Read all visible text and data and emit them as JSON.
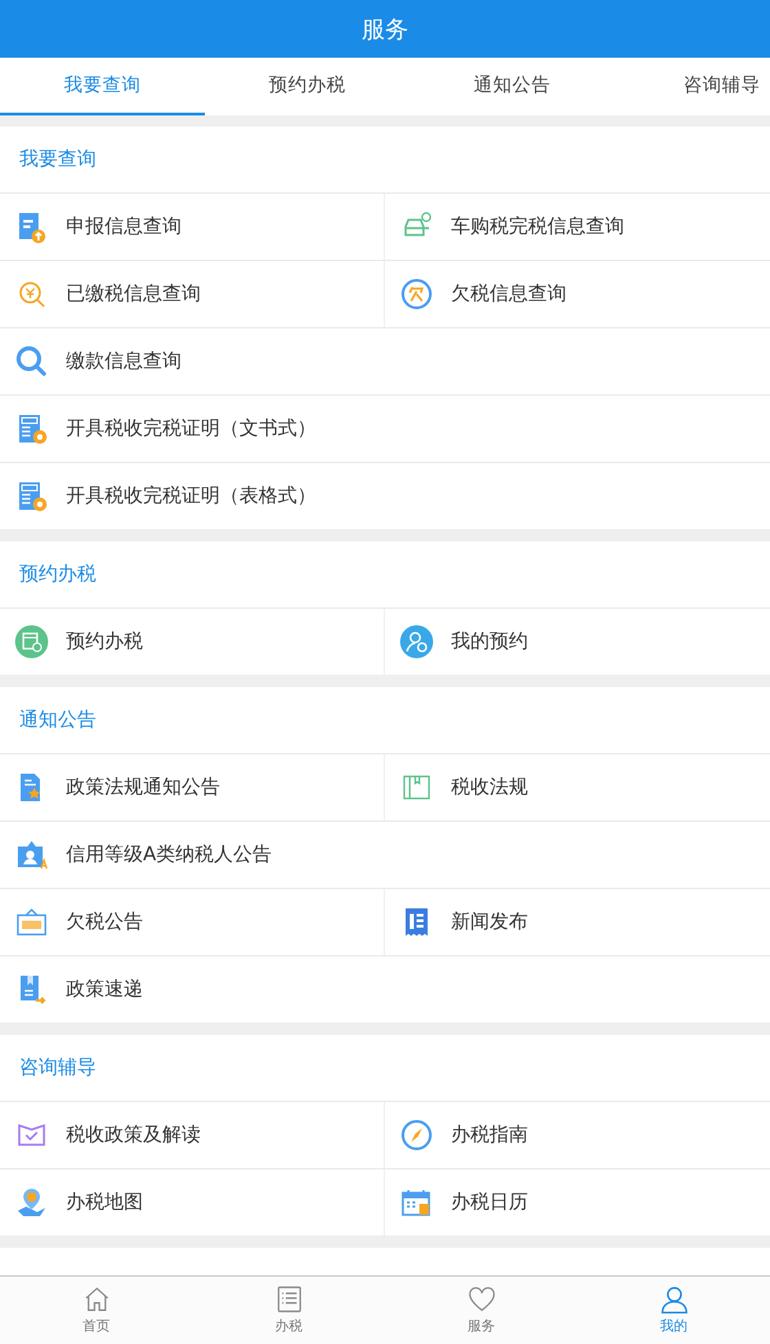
{
  "header": {
    "title": "服务"
  },
  "tabs": [
    {
      "label": "我要查询",
      "selected": true
    },
    {
      "label": "预约办税",
      "selected": false
    },
    {
      "label": "通知公告",
      "selected": false
    },
    {
      "label": "咨询辅导",
      "selected": false
    }
  ],
  "sections": [
    {
      "title": "我要查询",
      "rows": [
        [
          {
            "label": "申报信息查询"
          },
          {
            "label": "车购税完税信息查询"
          }
        ],
        [
          {
            "label": "已缴税信息查询"
          },
          {
            "label": "欠税信息查询"
          }
        ],
        [
          {
            "label": "缴款信息查询"
          }
        ],
        [
          {
            "label": "开具税收完税证明（文书式）"
          }
        ],
        [
          {
            "label": "开具税收完税证明（表格式）"
          }
        ]
      ]
    },
    {
      "title": "预约办税",
      "rows": [
        [
          {
            "label": "预约办税"
          },
          {
            "label": "我的预约"
          }
        ]
      ]
    },
    {
      "title": "通知公告",
      "rows": [
        [
          {
            "label": "政策法规通知公告"
          },
          {
            "label": "税收法规"
          }
        ],
        [
          {
            "label": "信用等级A类纳税人公告"
          }
        ],
        [
          {
            "label": "欠税公告"
          },
          {
            "label": "新闻发布"
          }
        ],
        [
          {
            "label": "政策速递"
          }
        ]
      ]
    },
    {
      "title": "咨询辅导",
      "rows": [
        [
          {
            "label": "税收政策及解读"
          },
          {
            "label": "办税指南"
          }
        ],
        [
          {
            "label": "办税地图"
          },
          {
            "label": "办税日历"
          }
        ]
      ]
    }
  ],
  "nav": [
    {
      "label": "首页",
      "selected": false
    },
    {
      "label": "办税",
      "selected": false
    },
    {
      "label": "服务",
      "selected": false
    },
    {
      "label": "我的",
      "selected": true
    }
  ]
}
